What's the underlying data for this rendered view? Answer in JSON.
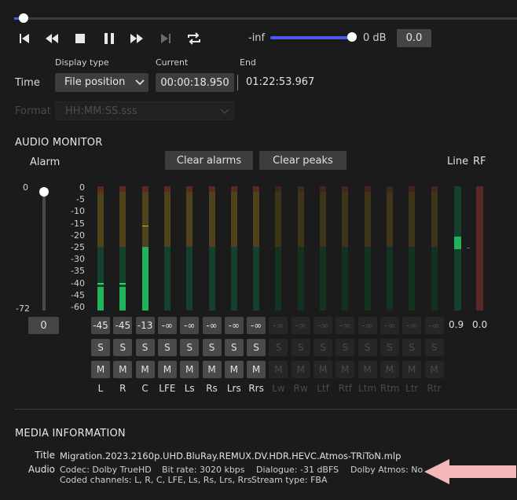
{
  "playback": {
    "seek_position": 0.006,
    "volume_min_label": "-inf",
    "volume_max_label": "0 dB",
    "volume_value": "0.0",
    "volume_level": 1.0
  },
  "time": {
    "label": "Time",
    "display_type_caption": "Display type",
    "display_type_value": "File position",
    "current_caption": "Current",
    "current_value": "00:00:18.950",
    "end_caption": "End",
    "end_value": "01:22:53.967",
    "format_label": "Format",
    "format_value": "HH:MM:SS.sss"
  },
  "audio_monitor": {
    "title": "AUDIO MONITOR",
    "alarm_label": "Alarm",
    "alarm_top": "0",
    "alarm_bottom": "-72",
    "alarm_value": "0",
    "clear_alarms": "Clear alarms",
    "clear_peaks": "Clear peaks",
    "line_label": "Line",
    "rf_label": "RF",
    "line_value": "0.9",
    "rf_value": "0.0",
    "line_level_db": -20,
    "scale": [
      "0",
      "-5",
      "-10",
      "-15",
      "-20",
      "-25",
      "-30",
      "-35",
      "-40",
      "-45",
      "-60"
    ],
    "solo_label": "S",
    "mute_label": "M",
    "channels": [
      {
        "name": "L",
        "peak": "-45",
        "active": true,
        "level_db": -45
      },
      {
        "name": "R",
        "peak": "-45",
        "active": true,
        "level_db": -45
      },
      {
        "name": "C",
        "peak": "-13",
        "active": true,
        "level_db": -20
      },
      {
        "name": "LFE",
        "peak": "-∞",
        "active": true
      },
      {
        "name": "Ls",
        "peak": "-∞",
        "active": true
      },
      {
        "name": "Rs",
        "peak": "-∞",
        "active": true
      },
      {
        "name": "Lrs",
        "peak": "-∞",
        "active": true
      },
      {
        "name": "Rrs",
        "peak": "-∞",
        "active": true
      },
      {
        "name": "Lw",
        "peak": "-∞",
        "active": false
      },
      {
        "name": "Rw",
        "peak": "-∞",
        "active": false
      },
      {
        "name": "Ltf",
        "peak": "-∞",
        "active": false
      },
      {
        "name": "Rtf",
        "peak": "-∞",
        "active": false
      },
      {
        "name": "Ltm",
        "peak": "-∞",
        "active": false
      },
      {
        "name": "Rtm",
        "peak": "-∞",
        "active": false
      },
      {
        "name": "Ltr",
        "peak": "-∞",
        "active": false
      },
      {
        "name": "Rtr",
        "peak": "-∞",
        "active": false
      }
    ]
  },
  "media_info": {
    "title": "MEDIA INFORMATION",
    "title_key": "Title",
    "title_value": "Migration.2023.2160p.UHD.BluRay.REMUX.DV.HDR.HEVC.Atmos-TRiToN.mlp",
    "audio_key": "Audio",
    "codec": "Codec: Dolby TrueHD",
    "bitrate": "Bit rate: 3020 kbps",
    "dialogue": "Dialogue: -31 dBFS",
    "atmos": "Dolby Atmos: No",
    "coded_channels": "Coded channels: L, R, C, LFE, Ls, Rs, Lrs, Rrs",
    "stream_type": "Stream type: FBA"
  },
  "colors": {
    "accent": "#4a5cf0",
    "meter_green": "#20b35a",
    "arrow": "#f6b7b9"
  },
  "icons": [
    "skip-start-icon",
    "rewind-icon",
    "stop-icon",
    "pause-icon",
    "fast-forward-icon",
    "skip-end-icon",
    "repeat-icon",
    "chevron-down-icon",
    "arrow-left-icon"
  ]
}
